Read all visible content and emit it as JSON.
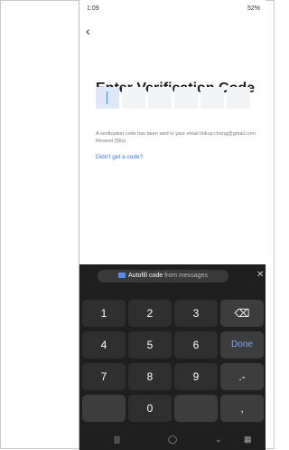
{
  "status_bar": {
    "time": "1:09",
    "right": "52%"
  },
  "title": "Enter Verification Code",
  "info_text": "A verification code has been sent to your email linkup.chong@gmail.com Resend (56s)",
  "link_text": "Didn't get a code?",
  "keyboard": {
    "suggestion": "Autofill code",
    "suggestion_source": "from messages",
    "keys": [
      "1",
      "2",
      "3",
      "⌫",
      "4",
      "5",
      "6",
      "Done",
      "7",
      "8",
      "9",
      ".-",
      " ",
      "0",
      ","
    ]
  }
}
